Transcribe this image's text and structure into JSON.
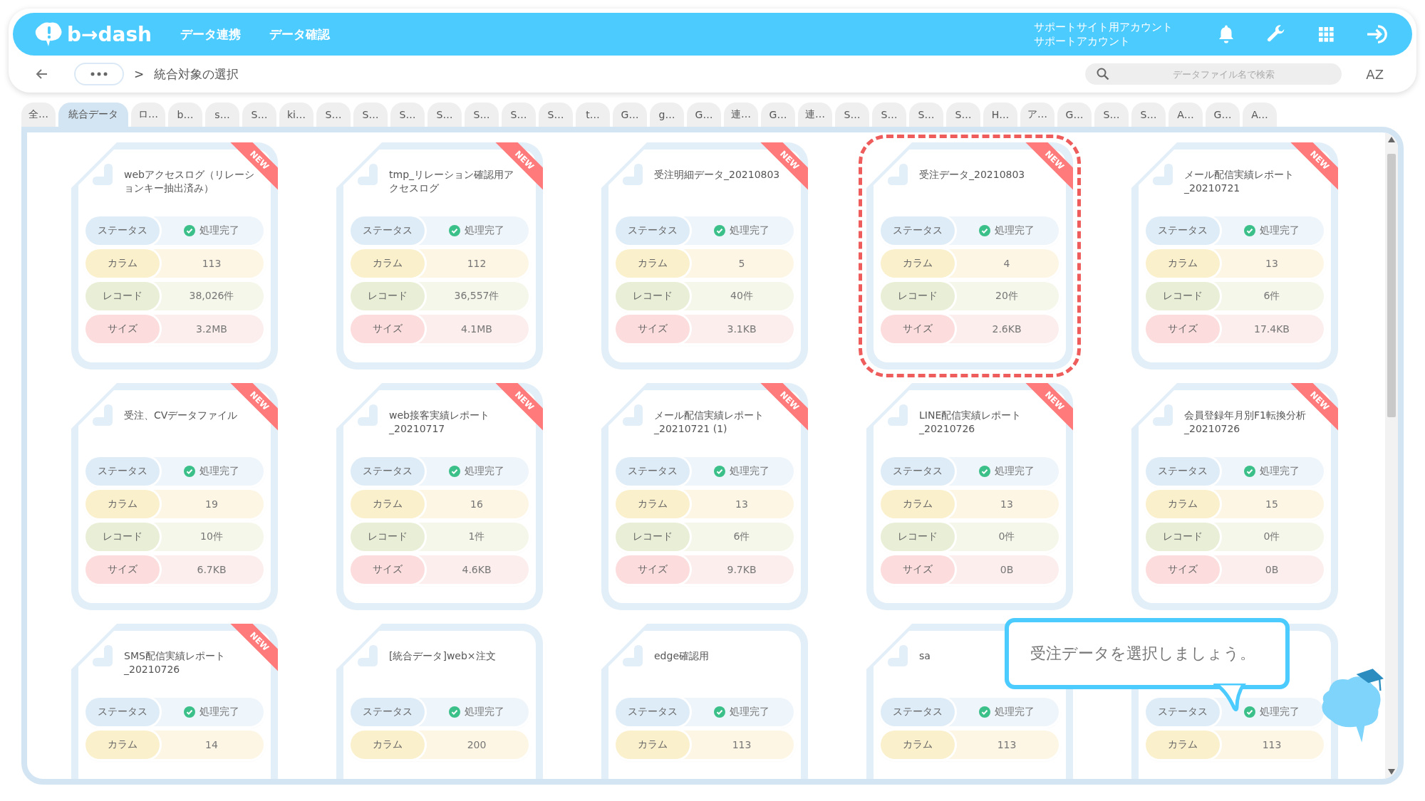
{
  "header": {
    "logo": "b→dash",
    "nav": [
      "データ連携",
      "データ確認"
    ],
    "account": [
      "サポートサイト用アカウント",
      "サポートアカウント"
    ]
  },
  "breadcrumb": {
    "separator": ">",
    "current": "統合対象の選択"
  },
  "search": {
    "placeholder": "データファイル名で検索"
  },
  "sort_label": "AZ",
  "tabs": [
    {
      "label": "全…",
      "selected": false
    },
    {
      "label": "統合データ",
      "selected": true
    },
    {
      "label": "ロ…",
      "selected": false
    },
    {
      "label": "b…",
      "selected": false
    },
    {
      "label": "s…",
      "selected": false
    },
    {
      "label": "S…",
      "selected": false
    },
    {
      "label": "ki…",
      "selected": false
    },
    {
      "label": "S…",
      "selected": false
    },
    {
      "label": "S…",
      "selected": false
    },
    {
      "label": "S…",
      "selected": false
    },
    {
      "label": "S…",
      "selected": false
    },
    {
      "label": "S…",
      "selected": false
    },
    {
      "label": "S…",
      "selected": false
    },
    {
      "label": "S…",
      "selected": false
    },
    {
      "label": "t…",
      "selected": false
    },
    {
      "label": "G…",
      "selected": false
    },
    {
      "label": "g…",
      "selected": false
    },
    {
      "label": "G…",
      "selected": false
    },
    {
      "label": "連…",
      "selected": false
    },
    {
      "label": "G…",
      "selected": false
    },
    {
      "label": "連…",
      "selected": false
    },
    {
      "label": "S…",
      "selected": false
    },
    {
      "label": "S…",
      "selected": false
    },
    {
      "label": "S…",
      "selected": false
    },
    {
      "label": "S…",
      "selected": false
    },
    {
      "label": "H…",
      "selected": false
    },
    {
      "label": "ア…",
      "selected": false
    },
    {
      "label": "G…",
      "selected": false
    },
    {
      "label": "S…",
      "selected": false
    },
    {
      "label": "S…",
      "selected": false
    },
    {
      "label": "A…",
      "selected": false
    },
    {
      "label": "G…",
      "selected": false
    },
    {
      "label": "A…",
      "selected": false
    }
  ],
  "cards": [
    {
      "title": "webアクセスログ（リレーションキー抽出済み）",
      "badge": "NEW",
      "selected": false,
      "rows": [
        {
          "kind": "status",
          "label": "ステータス",
          "value": "処理完了"
        },
        {
          "kind": "column",
          "label": "カラム",
          "value": "113"
        },
        {
          "kind": "record",
          "label": "レコード",
          "value": "38,026件"
        },
        {
          "kind": "size",
          "label": "サイズ",
          "value": "3.2MB"
        }
      ]
    },
    {
      "title": "tmp_リレーション確認用アクセスログ",
      "badge": "NEW",
      "selected": false,
      "rows": [
        {
          "kind": "status",
          "label": "ステータス",
          "value": "処理完了"
        },
        {
          "kind": "column",
          "label": "カラム",
          "value": "112"
        },
        {
          "kind": "record",
          "label": "レコード",
          "value": "36,557件"
        },
        {
          "kind": "size",
          "label": "サイズ",
          "value": "4.1MB"
        }
      ]
    },
    {
      "title": "受注明細データ_20210803",
      "badge": "NEW",
      "selected": false,
      "rows": [
        {
          "kind": "status",
          "label": "ステータス",
          "value": "処理完了"
        },
        {
          "kind": "column",
          "label": "カラム",
          "value": "5"
        },
        {
          "kind": "record",
          "label": "レコード",
          "value": "40件"
        },
        {
          "kind": "size",
          "label": "サイズ",
          "value": "3.1KB"
        }
      ]
    },
    {
      "title": "受注データ_20210803",
      "badge": "NEW",
      "selected": true,
      "rows": [
        {
          "kind": "status",
          "label": "ステータス",
          "value": "処理完了"
        },
        {
          "kind": "column",
          "label": "カラム",
          "value": "4"
        },
        {
          "kind": "record",
          "label": "レコード",
          "value": "20件"
        },
        {
          "kind": "size",
          "label": "サイズ",
          "value": "2.6KB"
        }
      ]
    },
    {
      "title": "メール配信実績レポート_20210721",
      "badge": "NEW",
      "selected": false,
      "rows": [
        {
          "kind": "status",
          "label": "ステータス",
          "value": "処理完了"
        },
        {
          "kind": "column",
          "label": "カラム",
          "value": "13"
        },
        {
          "kind": "record",
          "label": "レコード",
          "value": "6件"
        },
        {
          "kind": "size",
          "label": "サイズ",
          "value": "17.4KB"
        }
      ]
    },
    {
      "title": "受注、CVデータファイル",
      "badge": "NEW",
      "selected": false,
      "rows": [
        {
          "kind": "status",
          "label": "ステータス",
          "value": "処理完了"
        },
        {
          "kind": "column",
          "label": "カラム",
          "value": "19"
        },
        {
          "kind": "record",
          "label": "レコード",
          "value": "10件"
        },
        {
          "kind": "size",
          "label": "サイズ",
          "value": "6.7KB"
        }
      ]
    },
    {
      "title": "web接客実績レポート_20210717",
      "badge": "NEW",
      "selected": false,
      "rows": [
        {
          "kind": "status",
          "label": "ステータス",
          "value": "処理完了"
        },
        {
          "kind": "column",
          "label": "カラム",
          "value": "16"
        },
        {
          "kind": "record",
          "label": "レコード",
          "value": "1件"
        },
        {
          "kind": "size",
          "label": "サイズ",
          "value": "4.6KB"
        }
      ]
    },
    {
      "title": "メール配信実績レポート_20210721 (1)",
      "badge": "NEW",
      "selected": false,
      "rows": [
        {
          "kind": "status",
          "label": "ステータス",
          "value": "処理完了"
        },
        {
          "kind": "column",
          "label": "カラム",
          "value": "13"
        },
        {
          "kind": "record",
          "label": "レコード",
          "value": "6件"
        },
        {
          "kind": "size",
          "label": "サイズ",
          "value": "9.7KB"
        }
      ]
    },
    {
      "title": "LINE配信実績レポート_20210726",
      "badge": "NEW",
      "selected": false,
      "rows": [
        {
          "kind": "status",
          "label": "ステータス",
          "value": "処理完了"
        },
        {
          "kind": "column",
          "label": "カラム",
          "value": "13"
        },
        {
          "kind": "record",
          "label": "レコード",
          "value": "0件"
        },
        {
          "kind": "size",
          "label": "サイズ",
          "value": "0B"
        }
      ]
    },
    {
      "title": "会員登録年月別F1転換分析_20210726",
      "badge": "NEW",
      "selected": false,
      "rows": [
        {
          "kind": "status",
          "label": "ステータス",
          "value": "処理完了"
        },
        {
          "kind": "column",
          "label": "カラム",
          "value": "15"
        },
        {
          "kind": "record",
          "label": "レコード",
          "value": "0件"
        },
        {
          "kind": "size",
          "label": "サイズ",
          "value": "0B"
        }
      ]
    },
    {
      "title": "SMS配信実績レポート_20210726",
      "badge": "NEW",
      "selected": false,
      "rows": [
        {
          "kind": "status",
          "label": "ステータス",
          "value": "処理完了"
        },
        {
          "kind": "column",
          "label": "カラム",
          "value": "14"
        }
      ]
    },
    {
      "title": "[統合データ]web×注文",
      "selected": false,
      "rows": [
        {
          "kind": "status",
          "label": "ステータス",
          "value": "処理完了"
        },
        {
          "kind": "column",
          "label": "カラム",
          "value": "200"
        }
      ]
    },
    {
      "title": "edge確認用",
      "selected": false,
      "rows": [
        {
          "kind": "status",
          "label": "ステータス",
          "value": "処理完了"
        },
        {
          "kind": "column",
          "label": "カラム",
          "value": "113"
        }
      ]
    },
    {
      "title": "sa",
      "selected": false,
      "rows": [
        {
          "kind": "status",
          "label": "ステータス",
          "value": "処理完了"
        },
        {
          "kind": "column",
          "label": "カラム",
          "value": "113"
        }
      ]
    },
    {
      "selected": false,
      "rows": [
        {
          "kind": "status",
          "label": "ステータス",
          "value": "処理完了"
        },
        {
          "kind": "column",
          "label": "カラム",
          "value": "113"
        }
      ]
    }
  ],
  "tooltip": "受注データを選択しましょう。"
}
